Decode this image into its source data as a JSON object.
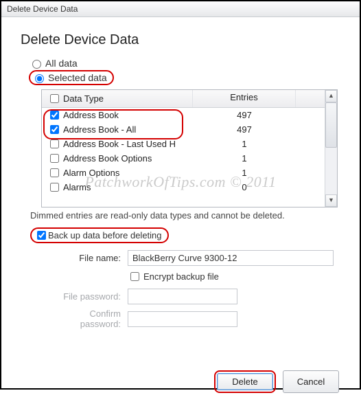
{
  "window": {
    "title": "Delete Device Data"
  },
  "page": {
    "heading": "Delete Device Data"
  },
  "scope": {
    "all_label": "All data",
    "selected_label": "Selected data",
    "value": "selected"
  },
  "table": {
    "header_type": "Data Type",
    "header_entries": "Entries",
    "rows": [
      {
        "label": "Address Book",
        "entries": "497",
        "checked": true
      },
      {
        "label": "Address Book - All",
        "entries": "497",
        "checked": true
      },
      {
        "label": "Address Book - Last Used H",
        "entries": "1",
        "checked": false
      },
      {
        "label": "Address Book Options",
        "entries": "1",
        "checked": false
      },
      {
        "label": "Alarm Options",
        "entries": "1",
        "checked": false
      },
      {
        "label": "Alarms",
        "entries": "0",
        "checked": false
      }
    ]
  },
  "note": "Dimmed entries are read-only data types and cannot be deleted.",
  "backup": {
    "checkbox_label": "Back up data before deleting",
    "checked": true,
    "file_label": "File name:",
    "file_value": "BlackBerry Curve 9300-12",
    "encrypt_label": "Encrypt backup file",
    "encrypt_checked": false,
    "pw_label": "File password:",
    "confirm_label": "Confirm password:"
  },
  "buttons": {
    "delete": "Delete",
    "cancel": "Cancel"
  },
  "watermark": "PatchworkOfTips.com © 2011"
}
